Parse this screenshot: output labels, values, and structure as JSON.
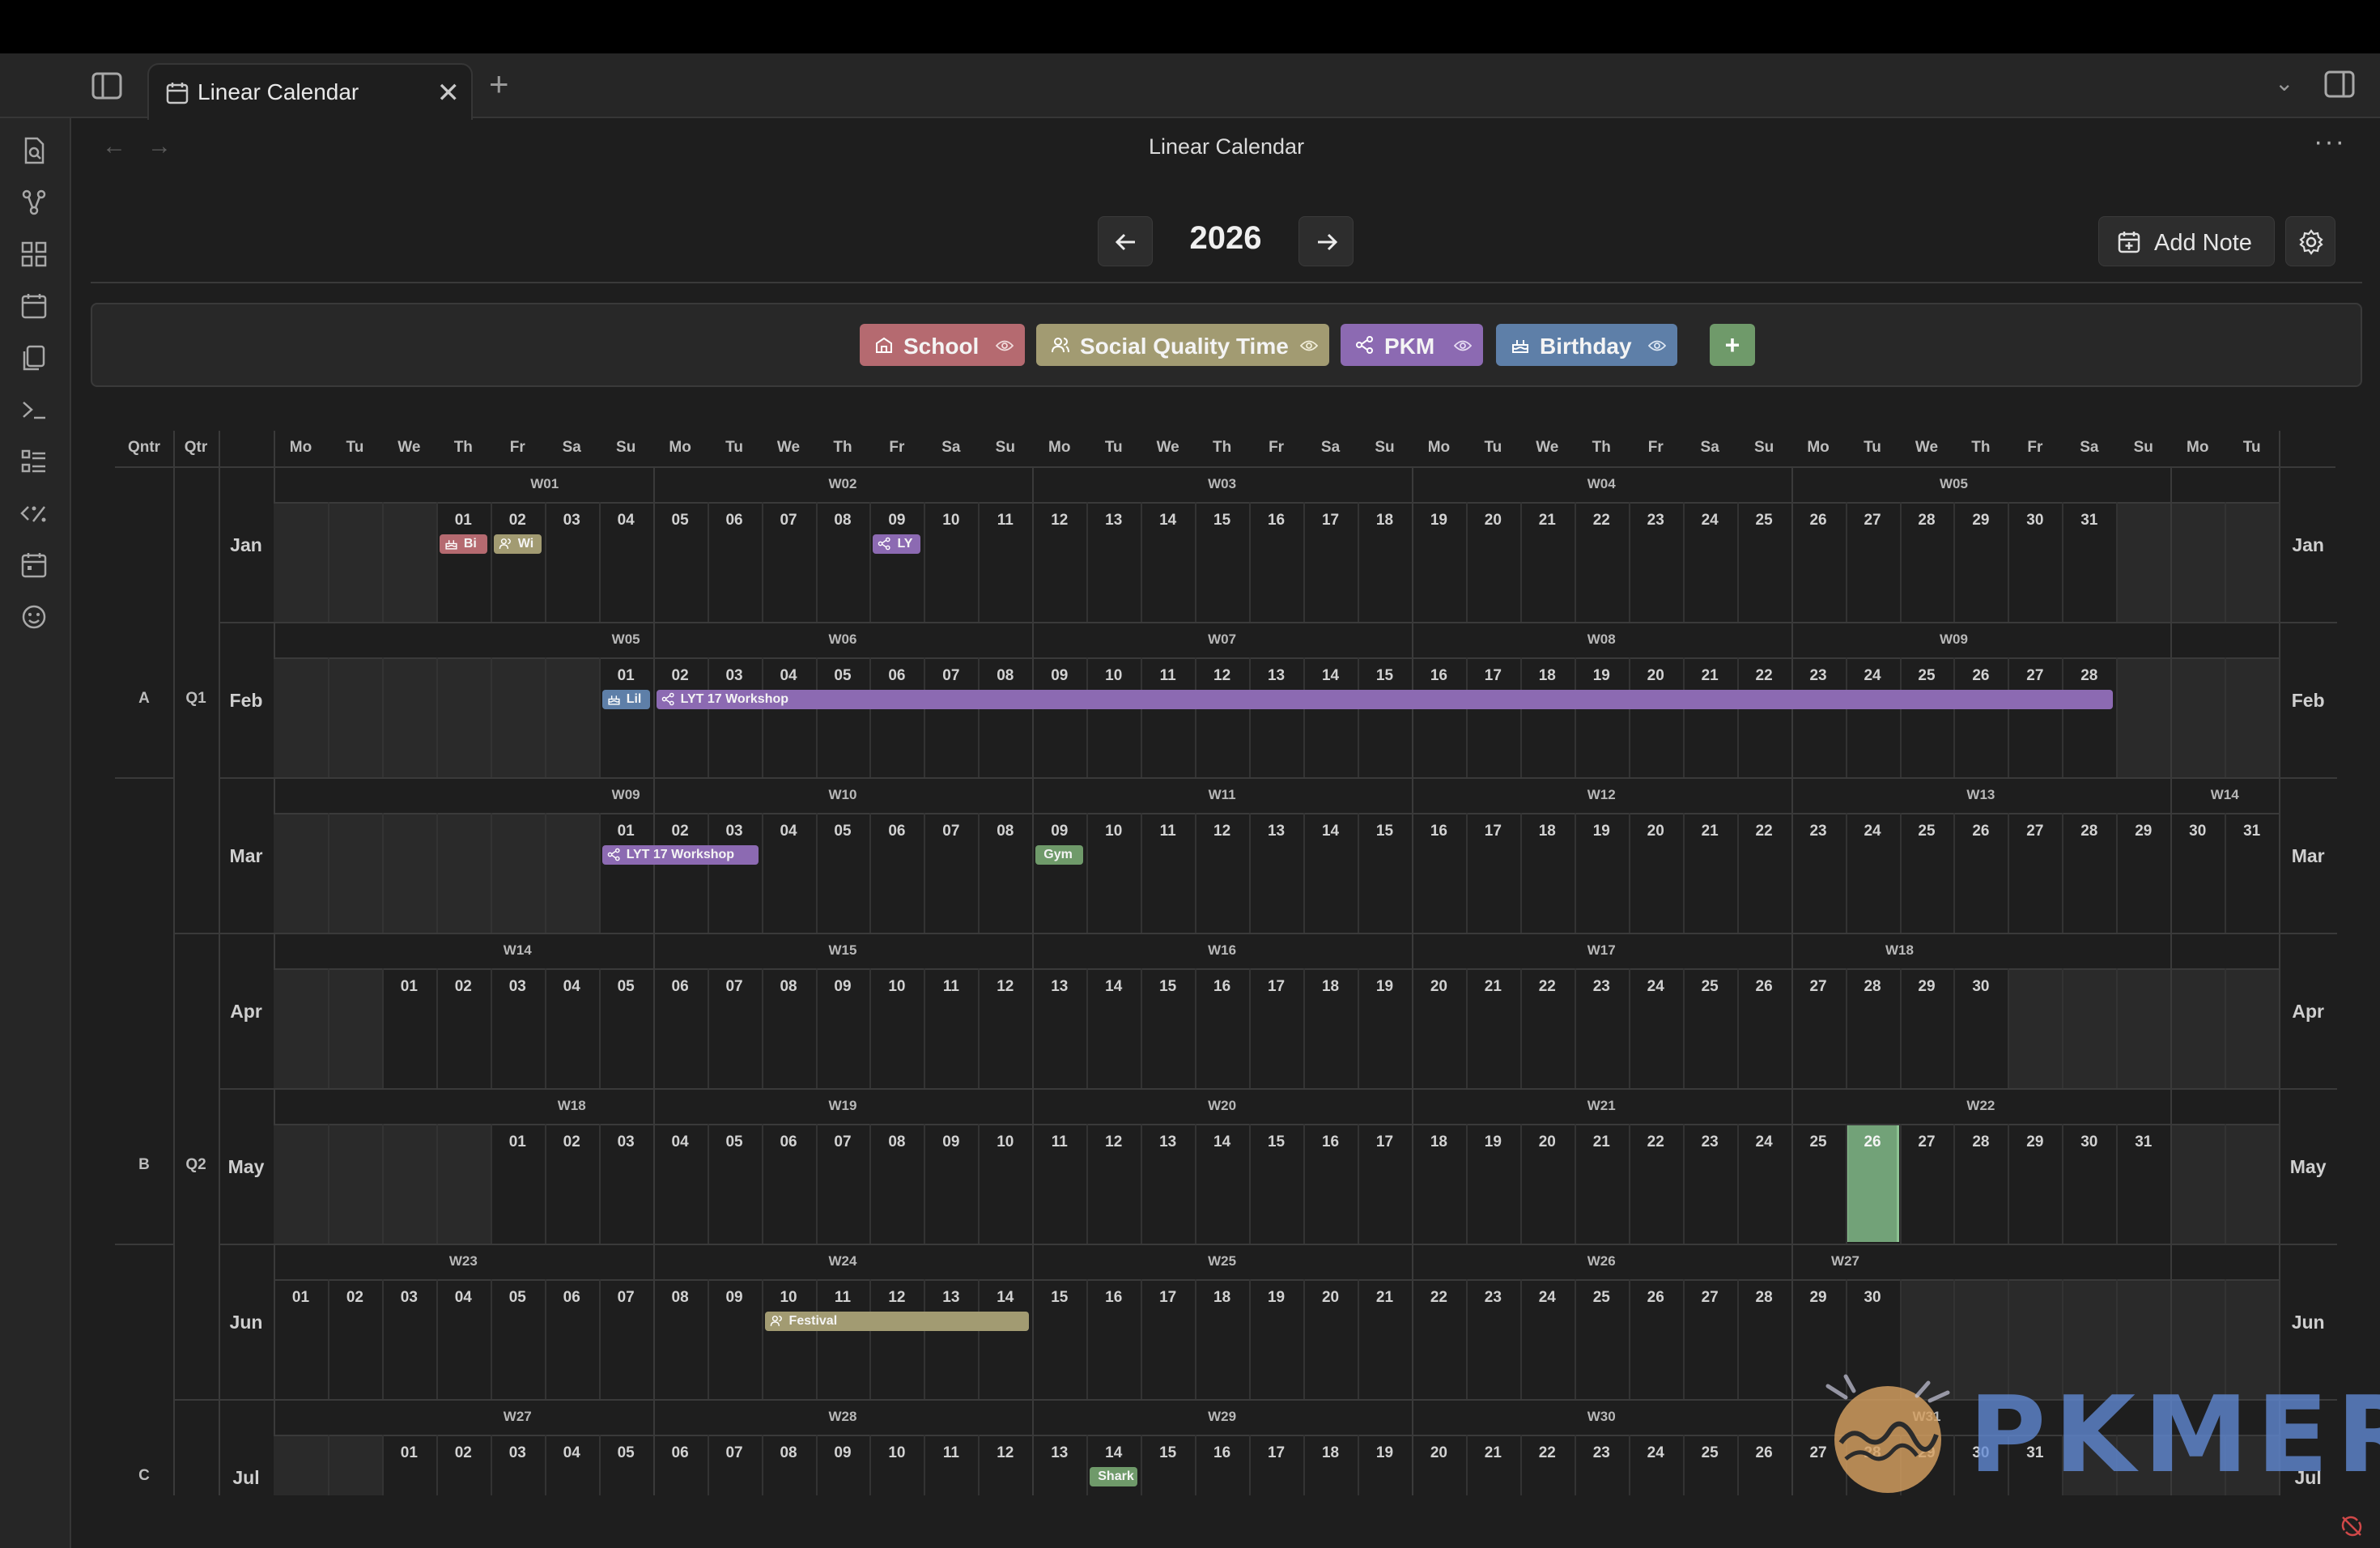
{
  "tab": {
    "title": "Linear Calendar",
    "close": "✕",
    "new": "+"
  },
  "view": {
    "title": "Linear Calendar",
    "more": "···",
    "back": "←",
    "forward": "→"
  },
  "toolbar": {
    "prev": "←",
    "next": "→",
    "year": "2026",
    "add_note": "Add Note"
  },
  "ribbon": [
    "quick-switcher-icon",
    "graph-icon",
    "canvas-icon",
    "daily-note-icon",
    "templates-icon",
    "command-palette-icon",
    "kanban-icon",
    "templater-icon",
    "calendar-icon",
    "emoji-icon"
  ],
  "categories": [
    {
      "name": "School",
      "color": "#b56a70",
      "icon": "school-icon"
    },
    {
      "name": "Social Quality Time",
      "color": "#a29b72",
      "icon": "people-icon"
    },
    {
      "name": "PKM",
      "color": "#8c6ab2",
      "icon": "network-icon"
    },
    {
      "name": "Birthday",
      "color": "#5e7fa8",
      "icon": "cake-icon"
    }
  ],
  "add_category": "+",
  "colors": {
    "today": "#72a278",
    "shade": "#2a2a2a",
    "gym": "#6f9a6a",
    "festival": "#a29b72"
  },
  "calendar": {
    "qntr_header": "Qntr",
    "qtr_header": "Qtr",
    "dow": [
      "Mo",
      "Tu",
      "We",
      "Th",
      "Fr",
      "Sa",
      "Su",
      "Mo",
      "Tu",
      "We",
      "Th",
      "Fr",
      "Sa",
      "Su",
      "Mo",
      "Tu",
      "We",
      "Th",
      "Fr",
      "Sa",
      "Su",
      "Mo",
      "Tu",
      "We",
      "Th",
      "Fr",
      "Sa",
      "Su",
      "Mo",
      "Tu",
      "We",
      "Th",
      "Fr",
      "Sa",
      "Su",
      "Mo",
      "Tu"
    ],
    "qntr_labels": [
      "A",
      "B",
      "C"
    ],
    "qtr_labels": [
      "Q1",
      "Q2"
    ],
    "today": {
      "month": 4,
      "day": 26
    },
    "months": [
      {
        "name": "Jan",
        "start": 3,
        "days": 31,
        "weeks": [
          {
            "label": "W01",
            "from": 3,
            "to": 7
          },
          {
            "label": "W02",
            "from": 7,
            "to": 14
          },
          {
            "label": "W03",
            "from": 14,
            "to": 21
          },
          {
            "label": "W04",
            "from": 21,
            "to": 28
          },
          {
            "label": "W05",
            "from": 28,
            "to": 34
          }
        ]
      },
      {
        "name": "Feb",
        "start": 6,
        "days": 28,
        "weeks": [
          {
            "label": "W05",
            "from": 6,
            "to": 7
          },
          {
            "label": "W06",
            "from": 7,
            "to": 14
          },
          {
            "label": "W07",
            "from": 14,
            "to": 21
          },
          {
            "label": "W08",
            "from": 21,
            "to": 28
          },
          {
            "label": "W09",
            "from": 28,
            "to": 34
          }
        ]
      },
      {
        "name": "Mar",
        "start": 6,
        "days": 31,
        "weeks": [
          {
            "label": "W09",
            "from": 6,
            "to": 7
          },
          {
            "label": "W10",
            "from": 7,
            "to": 14
          },
          {
            "label": "W11",
            "from": 14,
            "to": 21
          },
          {
            "label": "W12",
            "from": 21,
            "to": 28
          },
          {
            "label": "W13",
            "from": 28,
            "to": 35
          },
          {
            "label": "W14",
            "from": 35,
            "to": 37
          }
        ]
      },
      {
        "name": "Apr",
        "start": 2,
        "days": 30,
        "weeks": [
          {
            "label": "W14",
            "from": 2,
            "to": 7
          },
          {
            "label": "W15",
            "from": 7,
            "to": 14
          },
          {
            "label": "W16",
            "from": 14,
            "to": 21
          },
          {
            "label": "W17",
            "from": 21,
            "to": 28
          },
          {
            "label": "W18",
            "from": 28,
            "to": 32
          }
        ]
      },
      {
        "name": "May",
        "start": 4,
        "days": 31,
        "weeks": [
          {
            "label": "W18",
            "from": 4,
            "to": 7
          },
          {
            "label": "W19",
            "from": 7,
            "to": 14
          },
          {
            "label": "W20",
            "from": 14,
            "to": 21
          },
          {
            "label": "W21",
            "from": 21,
            "to": 28
          },
          {
            "label": "W22",
            "from": 28,
            "to": 35
          }
        ]
      },
      {
        "name": "Jun",
        "start": 0,
        "days": 30,
        "weeks": [
          {
            "label": "W23",
            "from": 0,
            "to": 7
          },
          {
            "label": "W24",
            "from": 7,
            "to": 14
          },
          {
            "label": "W25",
            "from": 14,
            "to": 21
          },
          {
            "label": "W26",
            "from": 21,
            "to": 28
          },
          {
            "label": "W27",
            "from": 28,
            "to": 30
          }
        ]
      },
      {
        "name": "Jul",
        "start": 2,
        "days": 31,
        "weeks": [
          {
            "label": "W27",
            "from": 2,
            "to": 7
          },
          {
            "label": "W28",
            "from": 7,
            "to": 14
          },
          {
            "label": "W29",
            "from": 14,
            "to": 21
          },
          {
            "label": "W30",
            "from": 21,
            "to": 28
          },
          {
            "label": "W31",
            "from": 28,
            "to": 33
          }
        ]
      }
    ],
    "events": [
      {
        "month": 0,
        "day": 1,
        "span": 1,
        "title": "Bi",
        "icon": "cake-icon",
        "color": "#b56a70"
      },
      {
        "month": 0,
        "day": 2,
        "span": 1,
        "title": "Wi",
        "icon": "people-icon",
        "color": "#a29b72"
      },
      {
        "month": 0,
        "day": 9,
        "span": 1,
        "title": "LY",
        "icon": "network-icon",
        "color": "#8c6ab2"
      },
      {
        "month": 1,
        "day": 1,
        "span": 1,
        "title": "Lil",
        "icon": "cake-icon",
        "color": "#5e7fa8"
      },
      {
        "month": 1,
        "day": 2,
        "span": 27,
        "title": "LYT 17 Workshop",
        "icon": "network-icon",
        "color": "#8c6ab2"
      },
      {
        "month": 2,
        "day": 1,
        "span": 3,
        "title": "LYT 17 Workshop",
        "icon": "network-icon",
        "color": "#8c6ab2"
      },
      {
        "month": 2,
        "day": 9,
        "span": 1,
        "title": "Gym",
        "icon": "",
        "color": "#6f9a6a"
      },
      {
        "month": 5,
        "day": 10,
        "span": 5,
        "title": "Festival",
        "icon": "people-icon",
        "color": "#a29b72"
      },
      {
        "month": 6,
        "day": 14,
        "span": 1,
        "title": "Shark",
        "icon": "",
        "color": "#6f9a6a"
      }
    ]
  },
  "watermark": "PKMER"
}
